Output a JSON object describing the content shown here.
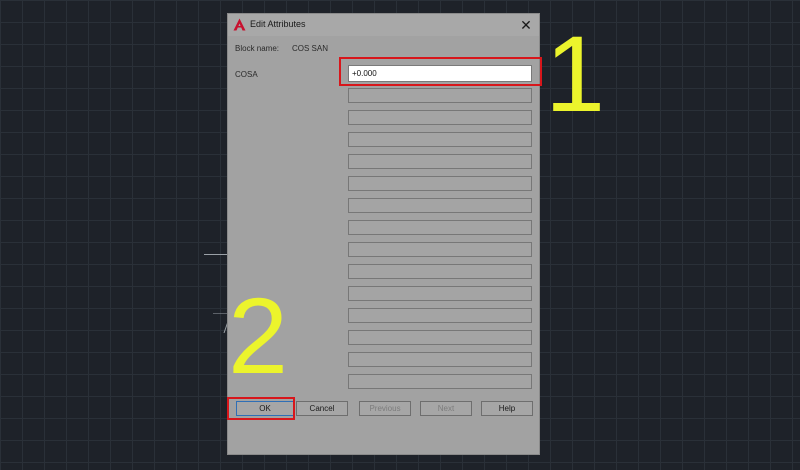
{
  "dialog": {
    "title": "Edit Attributes",
    "close_symbol": "✕",
    "block_name_label": "Block name:",
    "block_name_value": "COS SAN",
    "attribute": {
      "tag": "COSA",
      "value": "+0.000"
    },
    "empty_field_count": 14,
    "buttons": {
      "ok": "OK",
      "cancel": "Cancel",
      "previous": "Previous",
      "next": "Next",
      "help": "Help"
    }
  },
  "annotations": {
    "step1": "1",
    "step2": "2",
    "highlight_color": "#d8161b",
    "number_color": "#ecf42c"
  },
  "icons": {
    "app": "autocad-logo-icon",
    "close": "close-icon"
  }
}
